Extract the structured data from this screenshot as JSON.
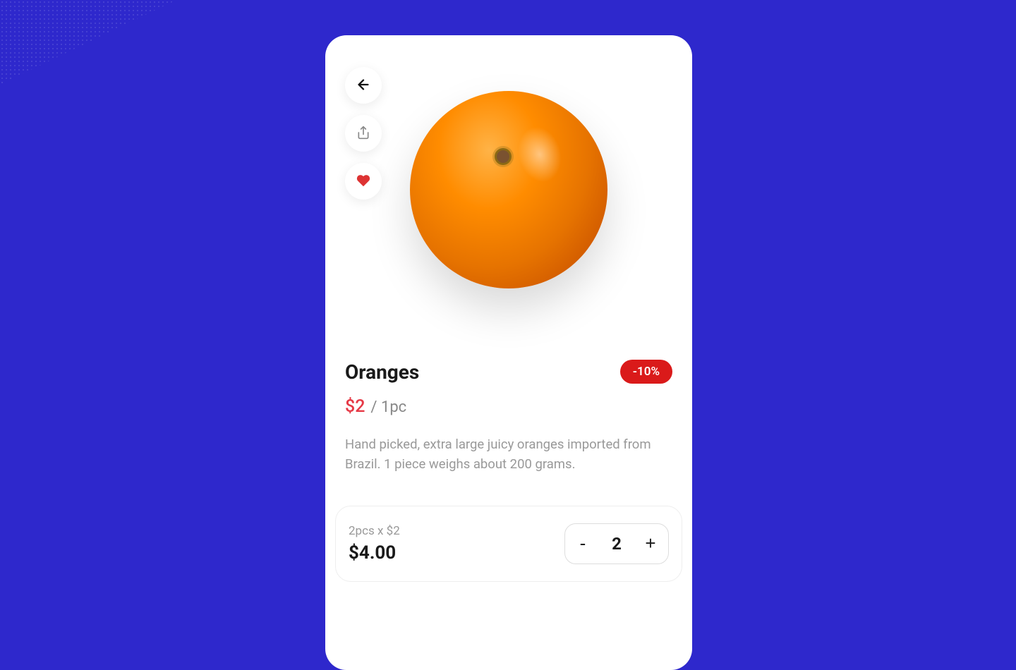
{
  "product": {
    "title": "Oranges",
    "discount_label": "-10%",
    "price": "$2",
    "price_unit": "/ 1pc",
    "description": "Hand picked, extra large juicy oranges imported from Brazil. 1 piece weighs about 200 grams."
  },
  "cart": {
    "breakdown": "2pcs x $2",
    "total": "$4.00",
    "quantity": "2",
    "decrement_label": "-",
    "increment_label": "+"
  },
  "icons": {
    "back": "back-arrow",
    "share": "share",
    "favorite": "heart"
  }
}
